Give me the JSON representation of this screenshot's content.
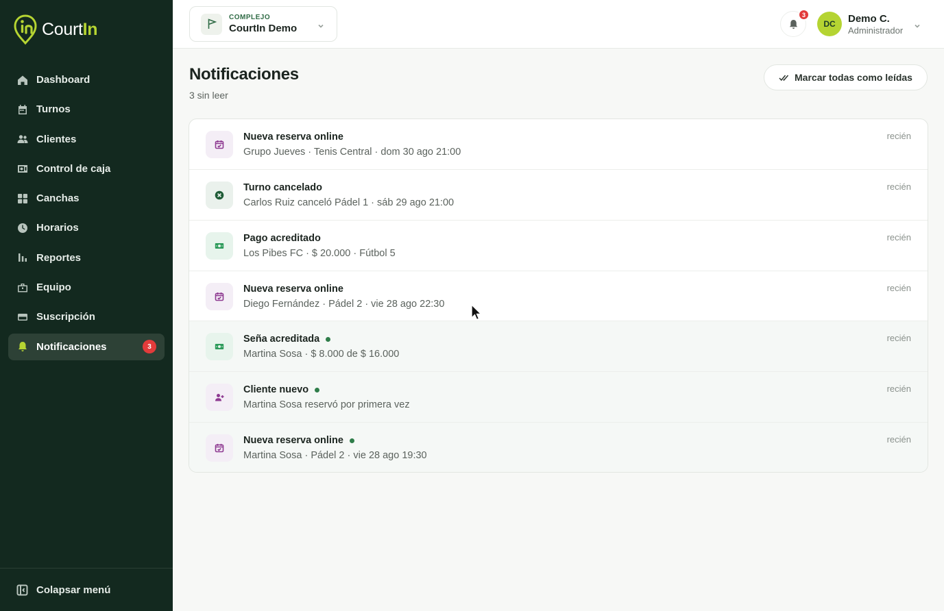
{
  "app": {
    "brand_prefix": "Court",
    "brand_suffix": "In"
  },
  "sidebar": {
    "items": [
      {
        "label": "Dashboard",
        "icon": "home-icon"
      },
      {
        "label": "Turnos",
        "icon": "calendar-icon"
      },
      {
        "label": "Clientes",
        "icon": "users-icon"
      },
      {
        "label": "Control de caja",
        "icon": "cash-register-icon"
      },
      {
        "label": "Canchas",
        "icon": "grid-icon"
      },
      {
        "label": "Horarios",
        "icon": "clock-icon"
      },
      {
        "label": "Reportes",
        "icon": "bar-chart-icon"
      },
      {
        "label": "Equipo",
        "icon": "briefcase-icon"
      },
      {
        "label": "Suscripción",
        "icon": "credit-card-icon"
      },
      {
        "label": "Notificaciones",
        "icon": "bell-icon",
        "active": true,
        "badge": "3"
      }
    ],
    "collapse_label": "Colapsar menú"
  },
  "header": {
    "complex_label": "COMPLEJO",
    "complex_name": "CourtIn Demo",
    "notification_count": "3",
    "user_initials": "DC",
    "user_name": "Demo C.",
    "user_role": "Administrador"
  },
  "main": {
    "title": "Notificaciones",
    "subtitle": "3 sin leer",
    "mark_all_label": "Marcar todas como leídas",
    "notifications": [
      {
        "type": "reservation",
        "icon": "calendar-check-icon",
        "title": "Nueva reserva online",
        "description": "Grupo Jueves · Tenis Central · dom 30 ago 21:00",
        "time": "recién",
        "unread": false
      },
      {
        "type": "cancellation",
        "icon": "x-circle-icon",
        "title": "Turno cancelado",
        "description": "Carlos Ruiz canceló Pádel 1 · sáb 29 ago 21:00",
        "time": "recién",
        "unread": false
      },
      {
        "type": "payment",
        "icon": "cash-icon",
        "title": "Pago acreditado",
        "description": "Los Pibes FC · $ 20.000 · Fútbol 5",
        "time": "recién",
        "unread": false
      },
      {
        "type": "reservation",
        "icon": "calendar-check-icon",
        "title": "Nueva reserva online",
        "description": "Diego Fernández · Pádel 2 · vie 28 ago 22:30",
        "time": "recién",
        "unread": false
      },
      {
        "type": "payment",
        "icon": "cash-icon",
        "title": "Seña acreditada",
        "description": "Martina Sosa · $ 8.000 de $ 16.000",
        "time": "recién",
        "unread": true
      },
      {
        "type": "new_client",
        "icon": "user-plus-icon",
        "title": "Cliente nuevo",
        "description": "Martina Sosa reservó por primera vez",
        "time": "recién",
        "unread": true
      },
      {
        "type": "reservation",
        "icon": "calendar-check-icon",
        "title": "Nueva reserva online",
        "description": "Martina Sosa · Pádel 2 · vie 28 ago 19:30",
        "time": "recién",
        "unread": true
      }
    ]
  },
  "colors": {
    "sidebar_bg": "#13291f",
    "accent": "#b5d432",
    "badge": "#e23b3b",
    "unread_dot": "#2f7d4a"
  }
}
